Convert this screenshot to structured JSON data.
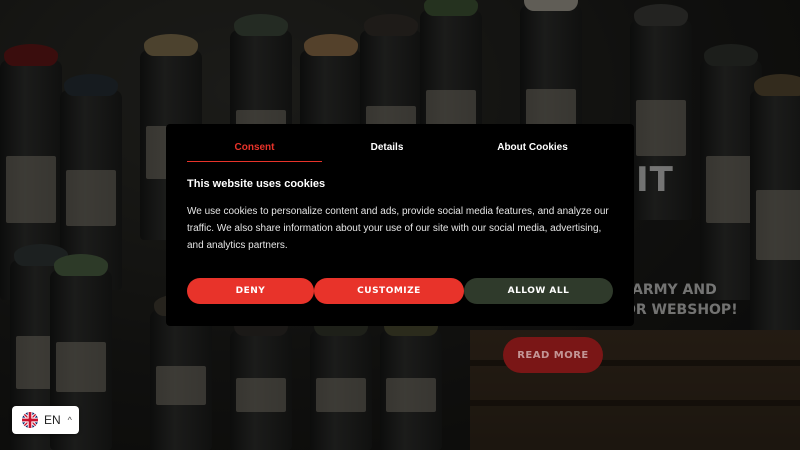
{
  "background": {
    "hero_heading_fragment": "IT",
    "hero_line1": "ARMY AND",
    "hero_line2": "OR WEBSHOP!",
    "read_more_label": "READ MORE"
  },
  "cookie_dialog": {
    "tabs": [
      {
        "label": "Consent",
        "active": true
      },
      {
        "label": "Details",
        "active": false
      },
      {
        "label": "About Cookies",
        "active": false
      }
    ],
    "title": "This website uses cookies",
    "body": "We use cookies to personalize content and ads, provide social media features, and analyze our traffic. We also share information about your use of our site with our social media, advertising, and analytics partners.",
    "buttons": {
      "deny": "DENY",
      "customize": "CUSTOMIZE",
      "allow_all": "ALLOW ALL"
    },
    "colors": {
      "accent": "#e8332a",
      "allow_all_bg": "#2f3a2b",
      "dialog_bg": "#000000"
    }
  },
  "language_switcher": {
    "flag_icon": "uk-flag-icon",
    "code": "EN",
    "chevron": "^"
  }
}
